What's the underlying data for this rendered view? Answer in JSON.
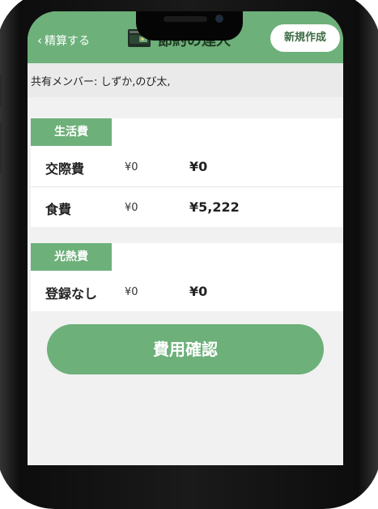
{
  "header": {
    "back_label": "精算する",
    "title": "節約の達人",
    "new_button": "新規作成"
  },
  "members": "共有メンバー: しずか,のび太,",
  "sections": [
    {
      "category": "生活費",
      "rows": [
        {
          "name": "交際費",
          "budget": "¥0",
          "amount": "¥0"
        },
        {
          "name": "食費",
          "budget": "¥0",
          "amount": "¥5,222"
        }
      ]
    },
    {
      "category": "光熱費",
      "rows": [
        {
          "name": "登録なし",
          "budget": "¥0",
          "amount": "¥0"
        }
      ]
    }
  ],
  "confirm_button": "費用確認",
  "colors": {
    "accent": "#6db07a",
    "header_text": "#1e3a22"
  }
}
